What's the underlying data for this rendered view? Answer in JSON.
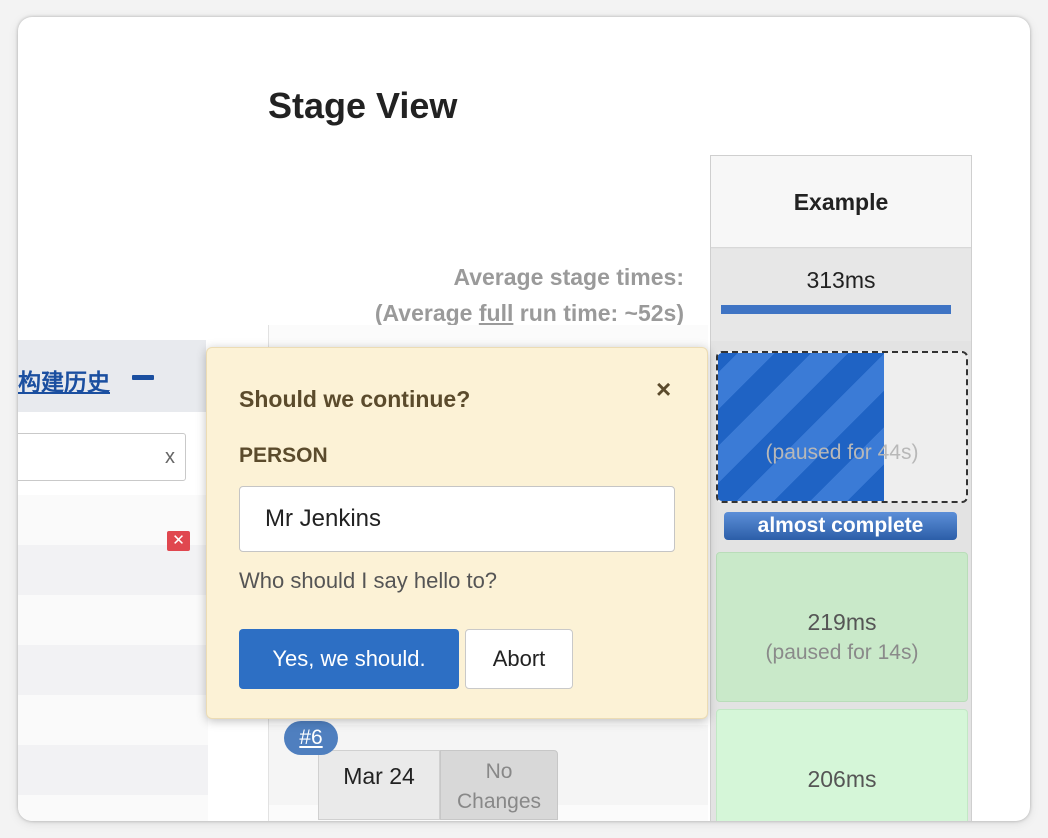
{
  "stage_view": {
    "title": "Stage View",
    "average_label": "Average stage times:",
    "average_full_prefix": "(Average ",
    "average_full_word": "full",
    "average_full_suffix": " run time: ~52s)"
  },
  "build_history": {
    "link": "构建历史",
    "filter_clear": "x"
  },
  "stage": {
    "name": "Example",
    "average_time": "313ms",
    "average_bar_fraction": 1.0,
    "running_progress_fraction": 0.67,
    "running_paused": "(paused for 44s)",
    "running_status": "almost complete",
    "cells": [
      {
        "time": "219ms",
        "paused": "(paused for 14s)"
      },
      {
        "time": "206ms"
      }
    ]
  },
  "build": {
    "number": "#6",
    "date": "Mar 24",
    "changes": "No Changes"
  },
  "input_prompt": {
    "title": "Should we continue?",
    "close": "×",
    "param_name": "PERSON",
    "param_value": "Mr Jenkins",
    "param_description": "Who should I say hello to?",
    "proceed": "Yes, we should.",
    "abort": "Abort"
  },
  "colors": {
    "primary_blue": "#2d6fc4",
    "success_green": "#c9e9c9",
    "popup_bg": "#fcf2d6"
  }
}
